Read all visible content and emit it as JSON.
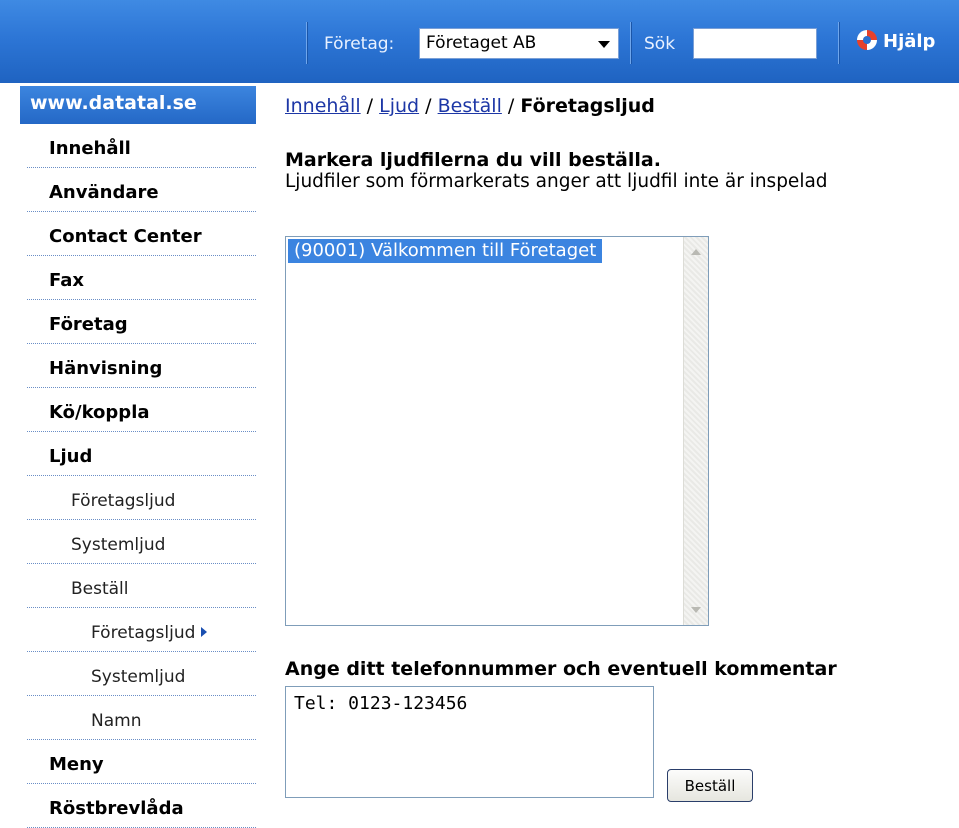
{
  "topbar": {
    "company_label": "Företag:",
    "company_selected": "Företaget AB",
    "search_label": "Sök",
    "search_value": "",
    "help_label": "Hjälp"
  },
  "sidebar": {
    "site": "www.datatal.se",
    "items": [
      {
        "label": "Innehåll",
        "level": 0
      },
      {
        "label": "Användare",
        "level": 0
      },
      {
        "label": "Contact Center",
        "level": 0
      },
      {
        "label": "Fax",
        "level": 0
      },
      {
        "label": "Företag",
        "level": 0
      },
      {
        "label": "Hänvisning",
        "level": 0
      },
      {
        "label": "Kö/koppla",
        "level": 0
      },
      {
        "label": "Ljud",
        "level": 0
      },
      {
        "label": "Företagsljud",
        "level": 1
      },
      {
        "label": "Systemljud",
        "level": 1
      },
      {
        "label": "Beställ",
        "level": 1
      },
      {
        "label": "Företagsljud",
        "level": 2,
        "active": true
      },
      {
        "label": "Systemljud",
        "level": 2
      },
      {
        "label": "Namn",
        "level": 2
      },
      {
        "label": "Meny",
        "level": 0
      },
      {
        "label": "Röstbrevlåda",
        "level": 0
      }
    ]
  },
  "breadcrumb": {
    "items": [
      "Innehåll",
      "Ljud",
      "Beställ"
    ],
    "separator": "/",
    "current": "Företagsljud"
  },
  "main": {
    "instruction_title": "Markera ljudfilerna du vill beställa.",
    "instruction_text": "Ljudfiler som förmarkerats anger att ljudfil inte är inspelad",
    "sound_files": [
      {
        "label": "(90001) Välkommen till Företaget",
        "selected": true
      }
    ],
    "phone_label": "Ange ditt telefonnummer och eventuell kommentar",
    "phone_value": "Tel: 0123-123456",
    "order_button": "Beställ"
  }
}
